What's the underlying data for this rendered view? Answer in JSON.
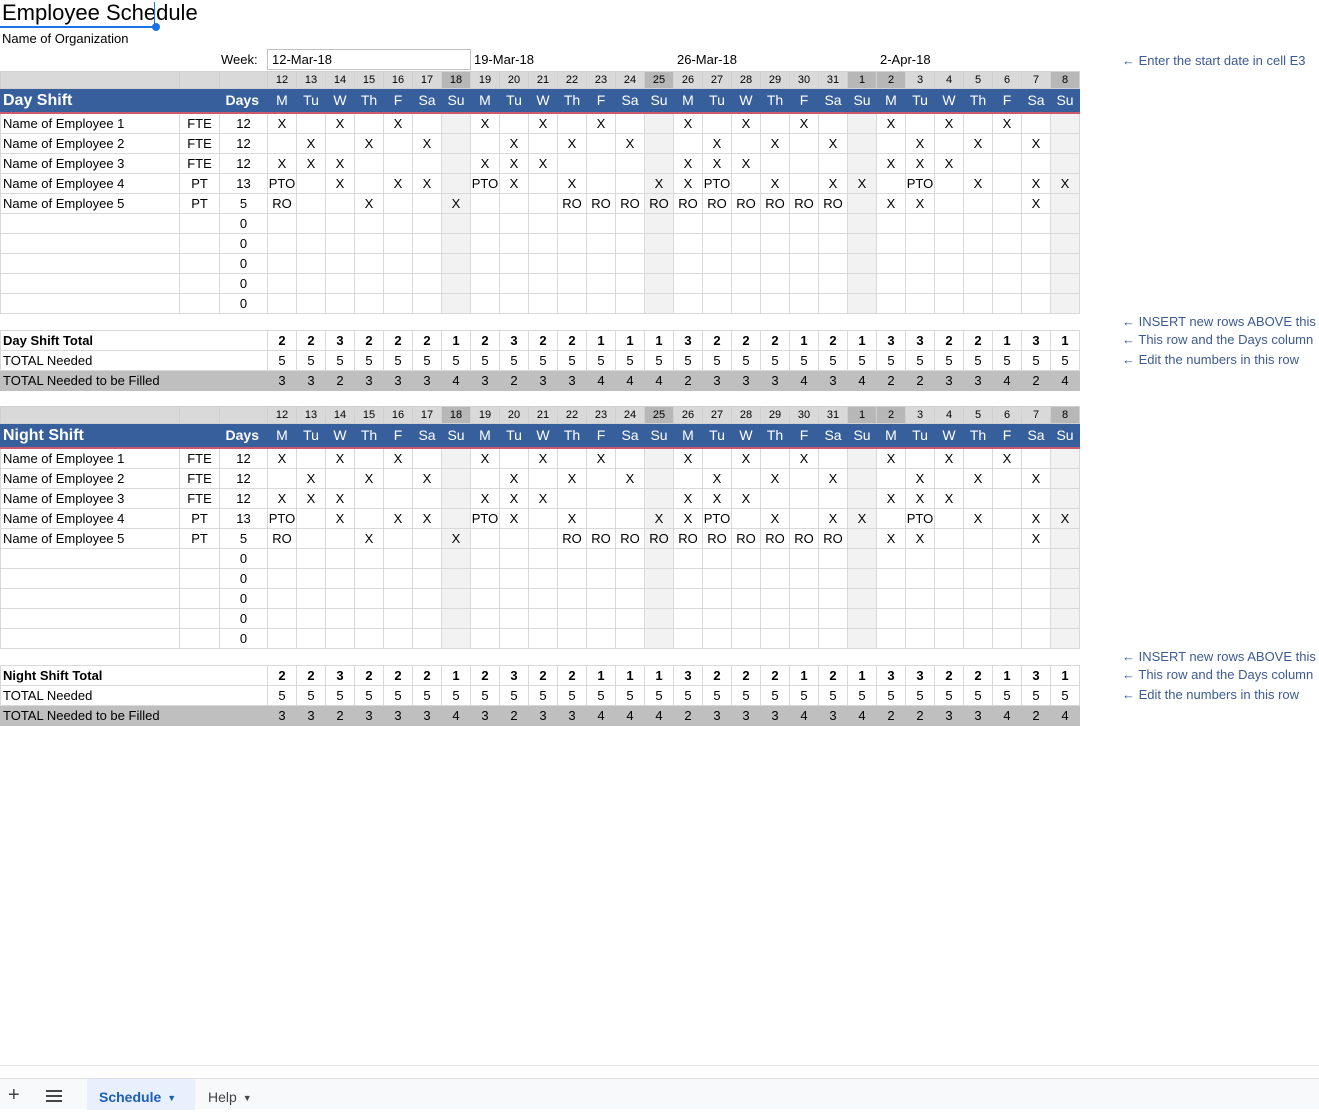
{
  "title": "Employee Schedule",
  "organization": "Name of Organization",
  "week_label": "Week:",
  "weeks": [
    "12-Mar-18",
    "19-Mar-18",
    "26-Mar-18",
    "2-Apr-18"
  ],
  "day_numbers": [
    "12",
    "13",
    "14",
    "15",
    "16",
    "17",
    "18",
    "19",
    "20",
    "21",
    "22",
    "23",
    "24",
    "25",
    "26",
    "27",
    "28",
    "29",
    "30",
    "31",
    "1",
    "2",
    "3",
    "4",
    "5",
    "6",
    "7",
    "8"
  ],
  "day_letters": [
    "M",
    "Tu",
    "W",
    "Th",
    "F",
    "Sa",
    "Su",
    "M",
    "Tu",
    "W",
    "Th",
    "F",
    "Sa",
    "Su",
    "M",
    "Tu",
    "W",
    "Th",
    "F",
    "Sa",
    "Su",
    "M",
    "Tu",
    "W",
    "Th",
    "F",
    "Sa",
    "Su"
  ],
  "days_header": "Days",
  "employees": [
    {
      "name": "Name of Employee 1",
      "type": "FTE",
      "days": "12",
      "cells": [
        "X",
        "",
        "X",
        "",
        "X",
        "",
        "",
        "X",
        "",
        "X",
        "",
        "X",
        "",
        "",
        "X",
        "",
        "X",
        "",
        "X",
        "",
        "",
        "X",
        "",
        "X",
        "",
        "X",
        "",
        ""
      ]
    },
    {
      "name": "Name of Employee 2",
      "type": "FTE",
      "days": "12",
      "cells": [
        "",
        "X",
        "",
        "X",
        "",
        "X",
        "",
        "",
        "X",
        "",
        "X",
        "",
        "X",
        "",
        "",
        "X",
        "",
        "X",
        "",
        "X",
        "",
        "",
        "X",
        "",
        "X",
        "",
        "X",
        ""
      ]
    },
    {
      "name": "Name of Employee 3",
      "type": "FTE",
      "days": "12",
      "cells": [
        "X",
        "X",
        "X",
        "",
        "",
        "",
        "",
        "X",
        "X",
        "X",
        "",
        "",
        "",
        "",
        "X",
        "X",
        "X",
        "",
        "",
        "",
        "",
        "X",
        "X",
        "X",
        "",
        "",
        "",
        ""
      ]
    },
    {
      "name": "Name of Employee 4",
      "type": "PT",
      "days": "13",
      "cells": [
        "PTO",
        "",
        "X",
        "",
        "X",
        "X",
        "",
        "PTO",
        "X",
        "",
        "X",
        "",
        "",
        "X",
        "X",
        "PTO",
        "",
        "X",
        "",
        "X",
        "X",
        "",
        "PTO",
        "",
        "X",
        "",
        "X",
        "X"
      ]
    },
    {
      "name": "Name of Employee 5",
      "type": "PT",
      "days": "5",
      "cells": [
        "RO",
        "",
        "",
        "X",
        "",
        "",
        "X",
        "",
        "",
        "",
        "RO",
        "RO",
        "RO",
        "RO",
        "RO",
        "RO",
        "RO",
        "RO",
        "RO",
        "RO",
        "",
        "X",
        "X",
        "",
        "",
        "",
        "X",
        ""
      ]
    }
  ],
  "blank_days": [
    "0",
    "0",
    "0",
    "0",
    "0"
  ],
  "day_shift": {
    "header": "Day Shift",
    "total_label": "Day Shift Total",
    "needed_label": "TOTAL Needed",
    "filled_label": "TOTAL Needed to be Filled"
  },
  "night_shift": {
    "header": "Night Shift",
    "total_label": "Night Shift Total",
    "needed_label": "TOTAL Needed",
    "filled_label": "TOTAL Needed to be Filled"
  },
  "totals": [
    "2",
    "2",
    "3",
    "2",
    "2",
    "2",
    "1",
    "2",
    "3",
    "2",
    "2",
    "1",
    "1",
    "1",
    "3",
    "2",
    "2",
    "2",
    "1",
    "2",
    "1",
    "3",
    "3",
    "2",
    "2",
    "1",
    "3",
    "1"
  ],
  "needed": [
    "5",
    "5",
    "5",
    "5",
    "5",
    "5",
    "5",
    "5",
    "5",
    "5",
    "5",
    "5",
    "5",
    "5",
    "5",
    "5",
    "5",
    "5",
    "5",
    "5",
    "5",
    "5",
    "5",
    "5",
    "5",
    "5",
    "5",
    "5"
  ],
  "to_fill": [
    "3",
    "3",
    "2",
    "3",
    "3",
    "3",
    "4",
    "3",
    "2",
    "3",
    "3",
    "4",
    "4",
    "4",
    "2",
    "3",
    "3",
    "3",
    "4",
    "3",
    "4",
    "2",
    "2",
    "3",
    "3",
    "4",
    "2",
    "4"
  ],
  "notes": {
    "start_date": "← Enter the start date in cell E3",
    "insert_rows": "← INSERT new rows ABOVE this",
    "days_column": "← This row and the Days column",
    "edit_numbers": "← Edit the numbers in this row"
  },
  "sheet_tabs": {
    "add": "+",
    "active": "Schedule",
    "second": "Help"
  },
  "colors": {
    "header_blue": "#365f9c",
    "weekend_gray": "#f2f2f2",
    "filled_gray": "#bfbfbf",
    "accent_red": "#cc5a6e",
    "note_blue": "#3c5a94"
  }
}
